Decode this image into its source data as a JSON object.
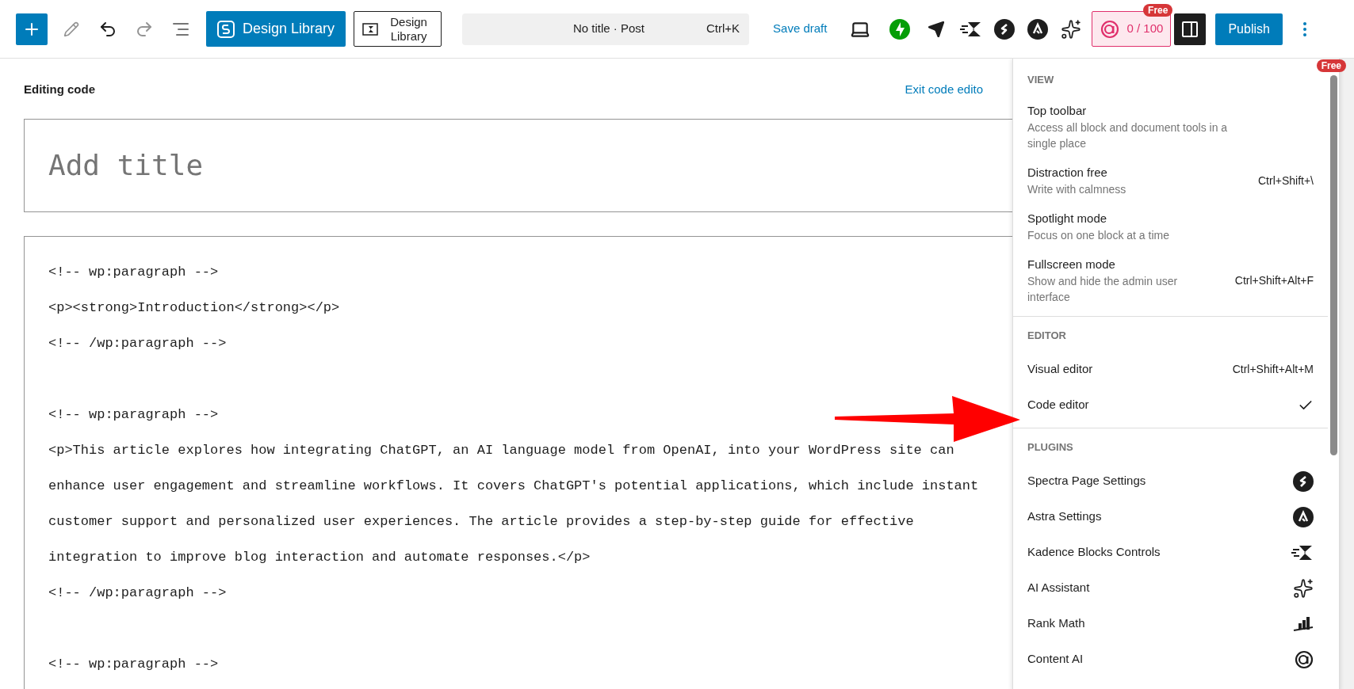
{
  "toolbar": {
    "design_library_buttons": [
      "Design Library",
      "Design Library"
    ],
    "document_title": "No title · Post",
    "shortcut": "Ctrl+K",
    "save_draft": "Save draft",
    "content_score": "0 / 100",
    "content_badge": "Free",
    "publish": "Publish",
    "sidebar_open": true
  },
  "editor": {
    "heading": "Editing code",
    "exit_link": "Exit code edito",
    "title_placeholder": "Add title",
    "code_blocks": [
      [
        "<!-- wp:paragraph -->",
        "<p><strong>Introduction</strong></p>",
        "<!-- /wp:paragraph -->"
      ],
      [
        "<!-- wp:paragraph -->",
        "<p>This article explores how integrating ChatGPT, an AI language model from OpenAI, into your WordPress site can",
        "enhance user engagement and streamline workflows. It covers ChatGPT's potential applications, which include instant",
        "customer support and personalized user experiences. The article provides a step-by-step guide for effective",
        "integration to improve blog interaction and automate responses.</p>",
        "<!-- /wp:paragraph -->"
      ],
      [
        "<!-- wp:paragraph -->"
      ]
    ]
  },
  "menu": {
    "badge": "Free",
    "sections": [
      {
        "title": "VIEW",
        "items": [
          {
            "kind": "toggle",
            "label": "Top toolbar",
            "description": "Access all block and document tools in a single place"
          },
          {
            "kind": "toggle",
            "label": "Distraction free",
            "description": "Write with calmness",
            "shortcut": "Ctrl+Shift+\\"
          },
          {
            "kind": "toggle",
            "label": "Spotlight mode",
            "description": "Focus on one block at a time"
          },
          {
            "kind": "toggle",
            "label": "Fullscreen mode",
            "description": "Show and hide the admin user interface",
            "shortcut": "Ctrl+Shift+Alt+F"
          }
        ]
      },
      {
        "title": "EDITOR",
        "items": [
          {
            "kind": "radio",
            "label": "Visual editor",
            "shortcut": "Ctrl+Shift+Alt+M",
            "selected": false
          },
          {
            "kind": "radio",
            "label": "Code editor",
            "selected": true
          }
        ]
      },
      {
        "title": "PLUGINS",
        "items": [
          {
            "kind": "plugin",
            "label": "Spectra Page Settings"
          },
          {
            "kind": "plugin",
            "label": "Astra Settings"
          },
          {
            "kind": "plugin",
            "label": "Kadence Blocks Controls"
          },
          {
            "kind": "plugin",
            "label": "AI Assistant"
          },
          {
            "kind": "plugin",
            "label": "Rank Math"
          },
          {
            "kind": "plugin",
            "label": "Content AI"
          }
        ]
      }
    ]
  }
}
